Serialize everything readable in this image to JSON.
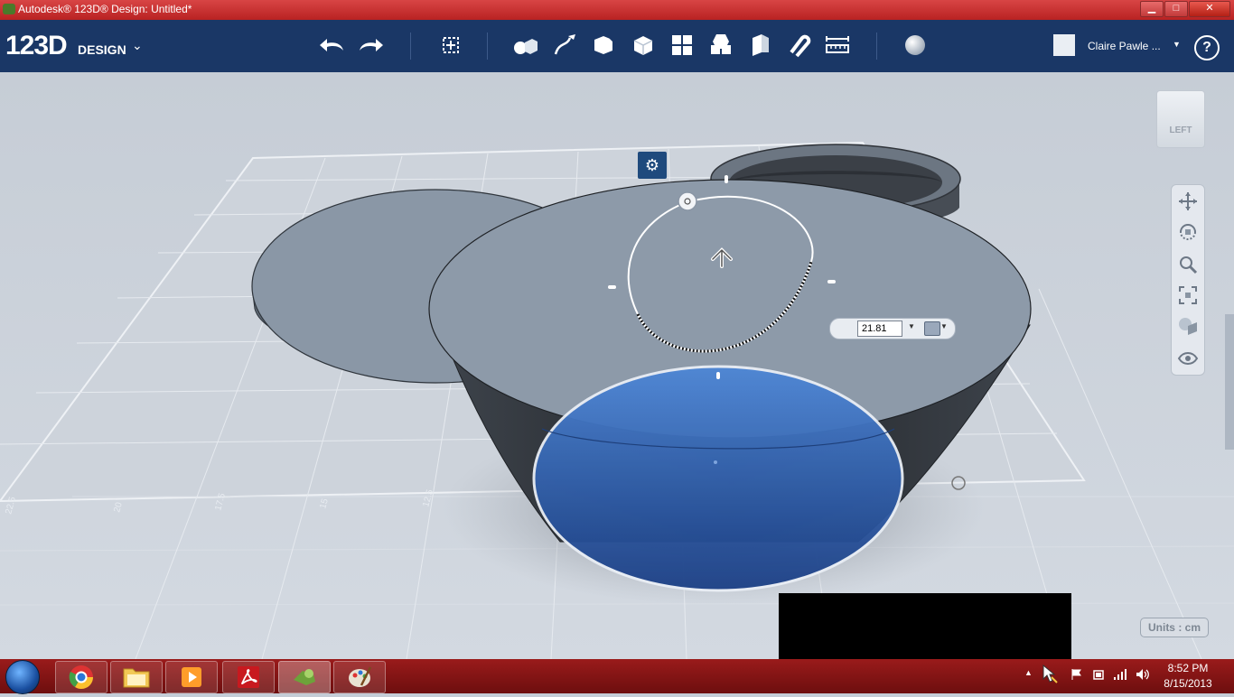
{
  "window": {
    "title": "Autodesk® 123D® Design: Untitled*",
    "min": "▁",
    "max": "□",
    "close": "✕"
  },
  "toolbar": {
    "logo_main": "123D",
    "logo_sub": "DESIGN",
    "logo_caret": "⌄",
    "user_name": "Claire Pawle ...",
    "user_caret": "▼",
    "help_label": "?"
  },
  "viewport": {
    "gear_label": "⚙",
    "dimension_value": "21.81",
    "dimension_caret": "▼",
    "snap_caret": "▼",
    "viewcube_label": "LEFT",
    "units_label": "Units : cm",
    "ruler_labels": [
      "22.5",
      "20",
      "17.5",
      "15",
      "12.5",
      "10"
    ]
  },
  "taskbar": {
    "time": "8:52 PM",
    "date": "8/15/2013",
    "tray_up": "▲"
  },
  "colors": {
    "title_bar": "#c62828",
    "toolbar": "#1a3766",
    "taskbar": "#8a1515",
    "selection_blue": "#2a5aaa",
    "model_gray": "#8e9aa8"
  },
  "icons": [
    "undo-icon",
    "redo-icon",
    "transform-icon",
    "primitives-icon",
    "sketch-icon",
    "construct-icon",
    "modify-icon",
    "pattern-icon",
    "group-icon",
    "combine-icon",
    "snap-icon",
    "measure-icon",
    "material-icon",
    "pan-icon",
    "orbit-icon",
    "zoom-icon",
    "fit-icon",
    "view-style-icon",
    "visibility-icon"
  ]
}
